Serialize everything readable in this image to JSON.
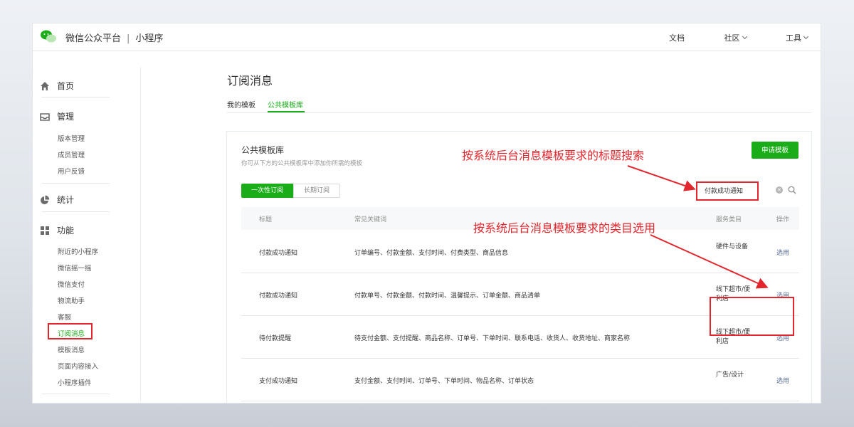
{
  "topbar": {
    "brand": "微信公众平台",
    "separator": "|",
    "product": "小程序",
    "nav": {
      "docs": "文档",
      "community": "社区",
      "tools": "工具"
    }
  },
  "sidebar": {
    "sections": {
      "home": "首页",
      "manage": "管理",
      "stats": "统计",
      "features": "功能"
    },
    "manage_items": [
      "版本管理",
      "成员管理",
      "用户反馈"
    ],
    "feature_items": [
      "附近的小程序",
      "微信摇一摇",
      "微信支付",
      "物流助手",
      "客服",
      "订阅消息",
      "模板消息",
      "页面内容接入",
      "小程序插件"
    ],
    "active_item": "订阅消息"
  },
  "main": {
    "title": "订阅消息",
    "tabs": [
      "我的模板",
      "公共模板库"
    ],
    "active_tab": "公共模板库",
    "card": {
      "title": "公共模板库",
      "desc": "你可从下方的公共模板库中添加你所需的模板",
      "apply_label": "申请模板",
      "segments": [
        "一次性订阅",
        "长期订阅"
      ],
      "search_value": "付款成功通知",
      "columns": [
        "标题",
        "常见关键词",
        "服务类目",
        "操作"
      ],
      "rows": [
        {
          "title": "付款成功通知",
          "keywords": "订单编号、付款金额、支付时间、付费类型、商品信息",
          "category": "硬件与设备",
          "action": "选用"
        },
        {
          "title": "付款成功通知",
          "keywords": "付款单号、付款金额、付款时间、温馨提示、订单金额、商品清单",
          "category": "线下超市/便利店",
          "action": "选用"
        },
        {
          "title": "待付款提醒",
          "keywords": "待支付金额、支付提醒、商品名称、订单号、下单时间、联系电话、收货人、收货地址、商家名称",
          "category": "线下超市/便利店",
          "action": "选用"
        },
        {
          "title": "支付成功通知",
          "keywords": "支付金额、支付时间、订单号、下单时间、物品名称、订单状态",
          "category": "广告/设计",
          "action": "选用"
        }
      ]
    }
  },
  "annotations": {
    "search_note": "按系统后台消息模板要求的标题搜索",
    "category_note": "按系统后台消息模板要求的类目选用"
  },
  "colors": {
    "accent": "#1aad19",
    "link": "#576b95",
    "annotation": "#e3262d"
  },
  "icons": {
    "home": "home-icon",
    "manage": "inbox-icon",
    "stats": "pie-chart-icon",
    "features": "grid-icon"
  }
}
